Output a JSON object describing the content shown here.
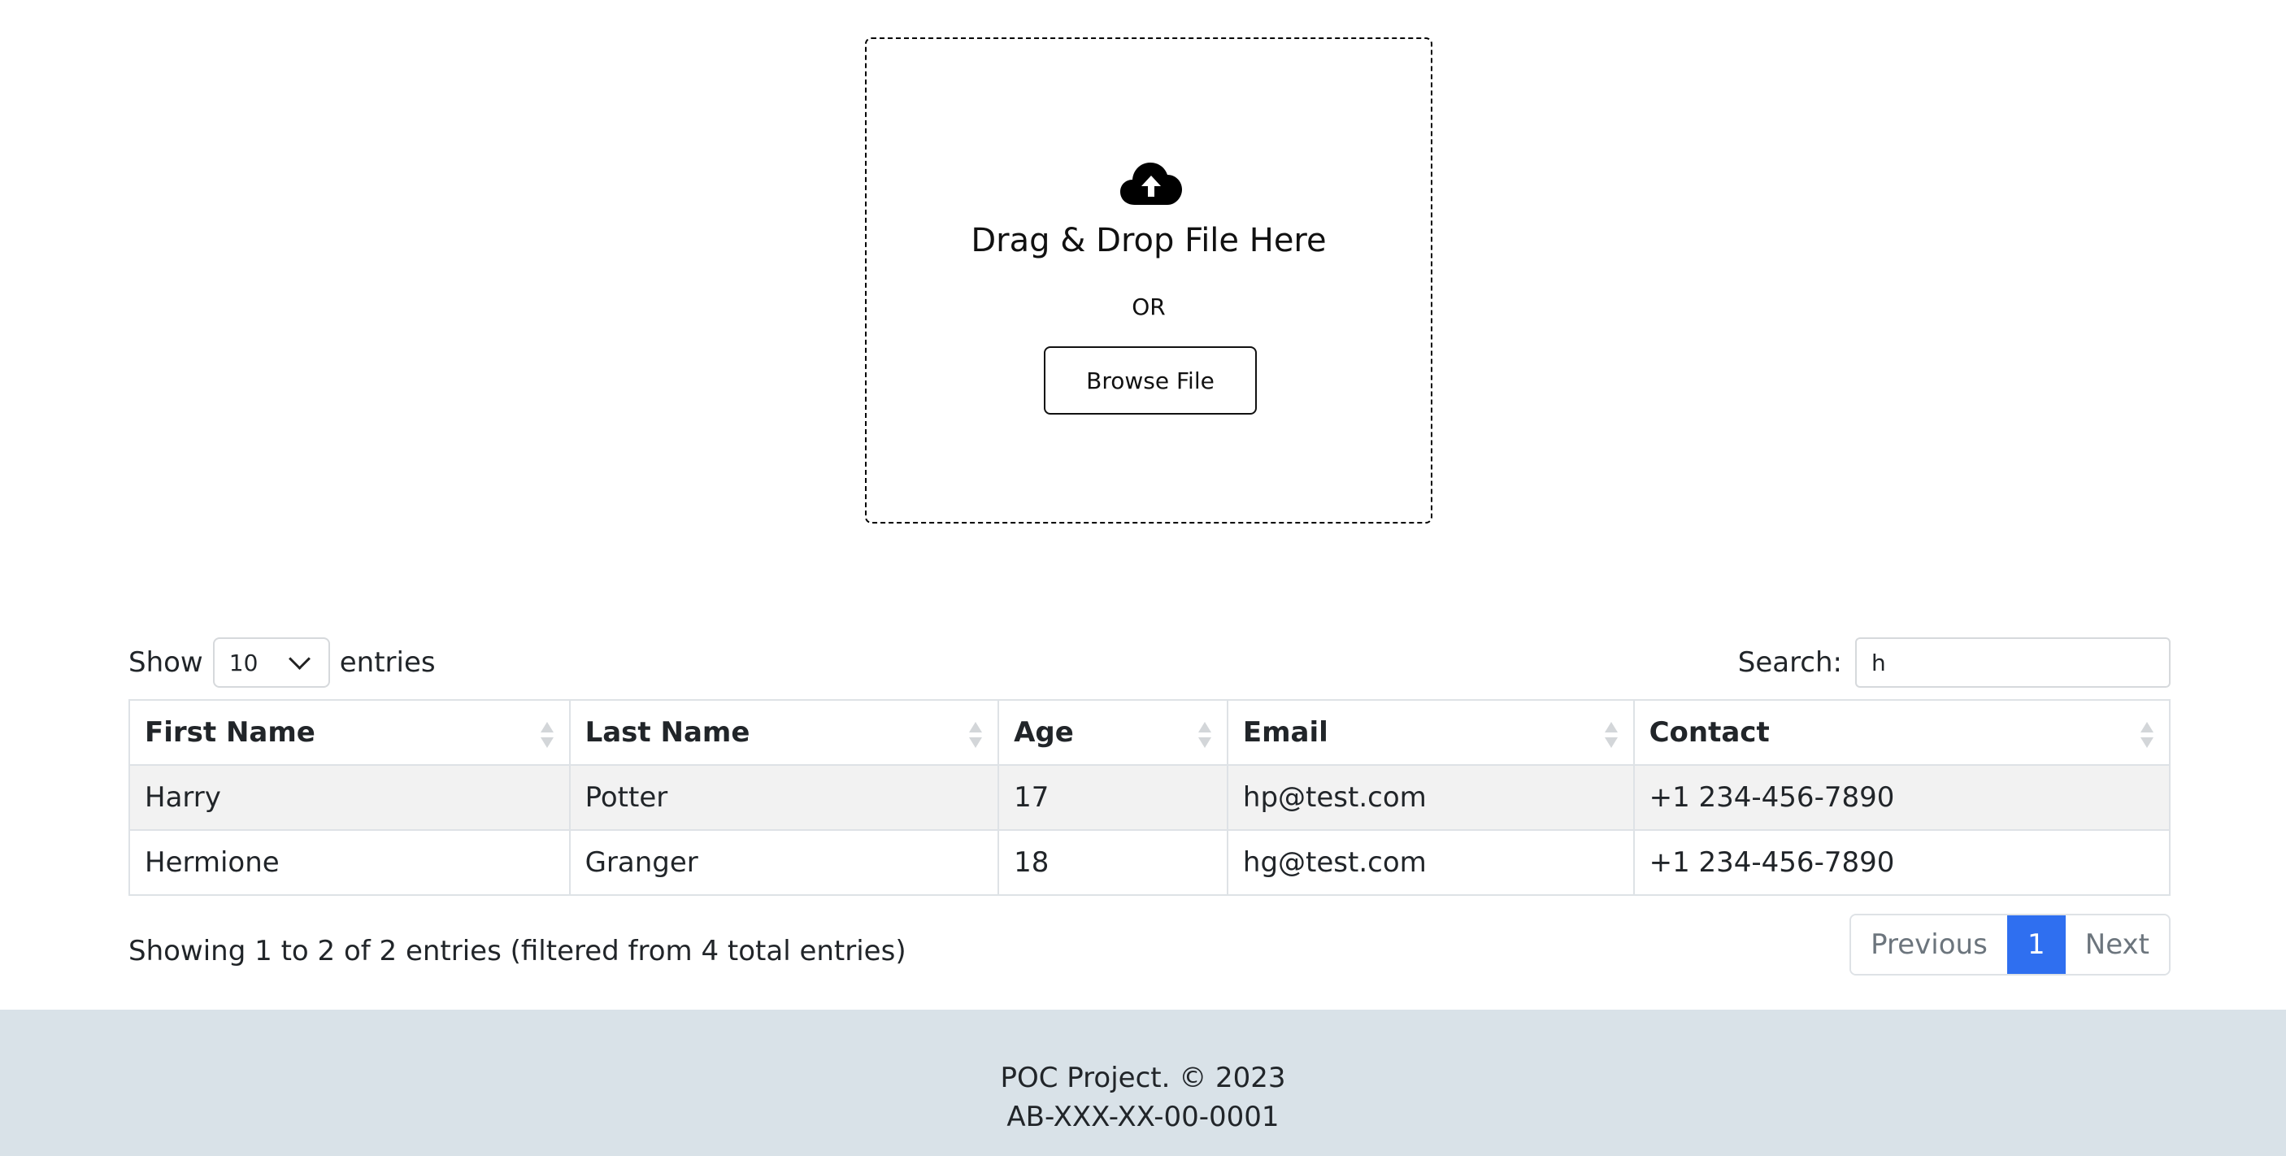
{
  "upload": {
    "icon": "cloud-upload-icon",
    "title": "Drag & Drop File Here",
    "or_text": "OR",
    "browse_label": "Browse File"
  },
  "table_controls": {
    "show_label": "Show",
    "page_length": "10",
    "entries_label": "entries",
    "search_label": "Search:",
    "search_value": "h"
  },
  "table": {
    "columns": [
      "First Name",
      "Last Name",
      "Age",
      "Email",
      "Contact"
    ],
    "rows": [
      [
        "Harry",
        "Potter",
        "17",
        "hp@test.com",
        "+1 234-456-7890"
      ],
      [
        "Hermione",
        "Granger",
        "18",
        "hg@test.com",
        "+1 234-456-7890"
      ]
    ]
  },
  "info_text": "Showing 1 to 2 of 2 entries (filtered from 4 total entries)",
  "pagination": {
    "previous": "Previous",
    "current": "1",
    "next": "Next"
  },
  "footer": {
    "line1": "POC Project. © 2023",
    "line2": "AB-XXX-XX-00-0001"
  },
  "colors": {
    "accent": "#2f6ff0",
    "footer_bg": "#d9e2e8",
    "stripe": "#f2f2f2"
  }
}
